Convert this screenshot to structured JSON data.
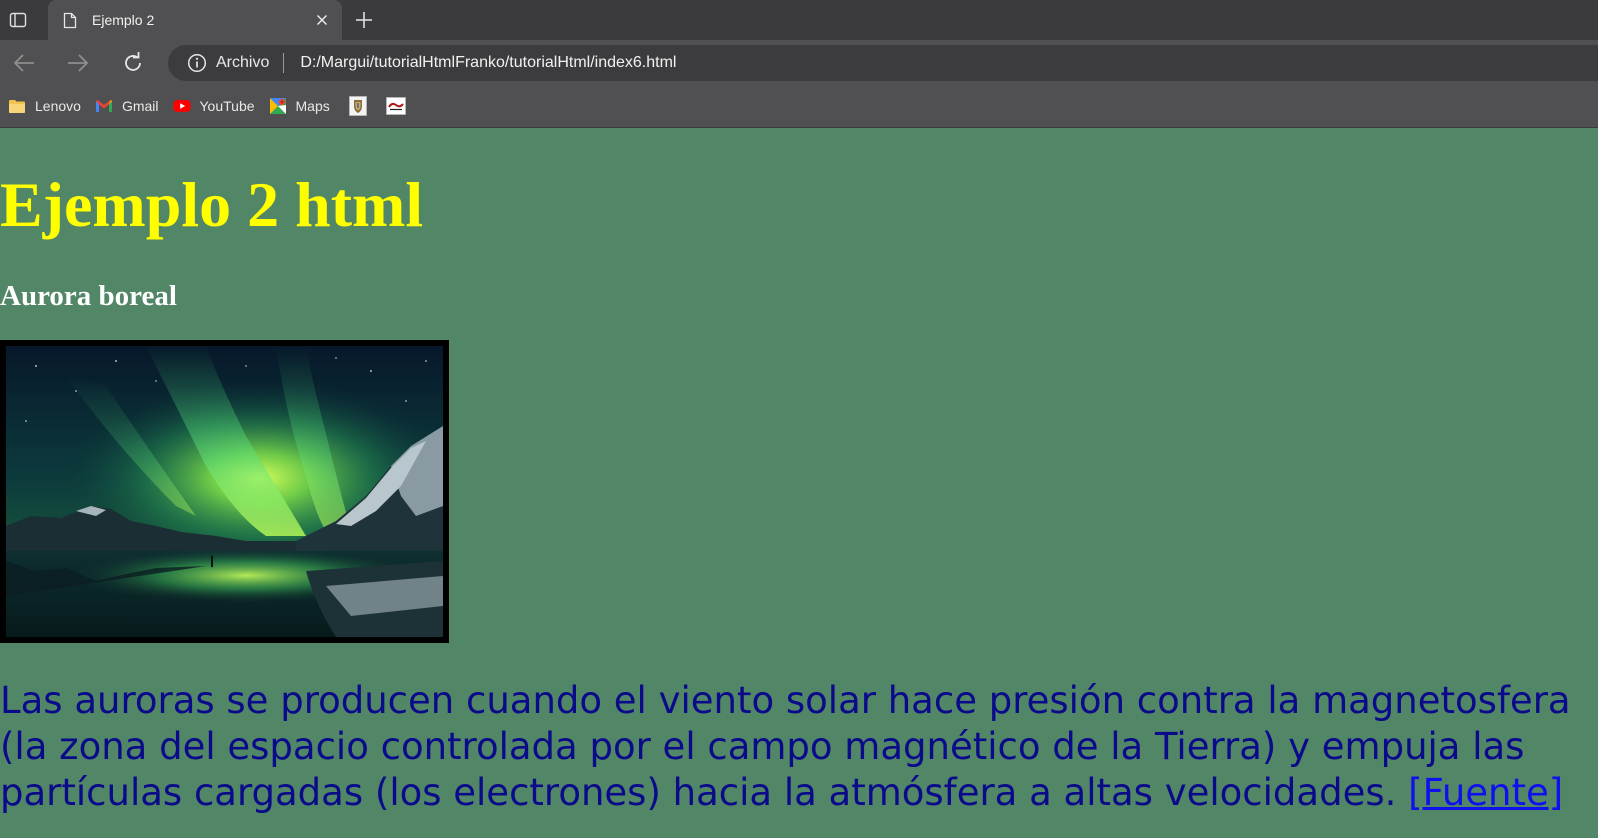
{
  "browser": {
    "tab_title": "Ejemplo 2",
    "address_scheme": "Archivo",
    "url": "D:/Margui/tutorialHtmlFranko/tutorialHtml/index6.html",
    "bookmarks": [
      {
        "label": "Lenovo",
        "icon": "folder-icon"
      },
      {
        "label": "Gmail",
        "icon": "gmail-icon"
      },
      {
        "label": "YouTube",
        "icon": "youtube-icon"
      },
      {
        "label": "Maps",
        "icon": "maps-icon"
      }
    ]
  },
  "page": {
    "heading": "Ejemplo 2 html",
    "subheading": "Aurora boreal",
    "image_subject": "aurora-borealis-photo",
    "paragraph": "Las auroras se producen cuando el viento solar hace presión contra la magnetosfera (la zona del espacio controlada por el campo magnético de la Tierra) y empuja las partículas cargadas (los electrones) hacia la atmósfera a altas velocidades.",
    "source_link": "[Fuente]"
  },
  "colors": {
    "page_background": "#518667",
    "heading": "#ffff00",
    "subheading": "#ffffff",
    "paragraph": "#0a0a8a",
    "link": "#1010ee"
  }
}
